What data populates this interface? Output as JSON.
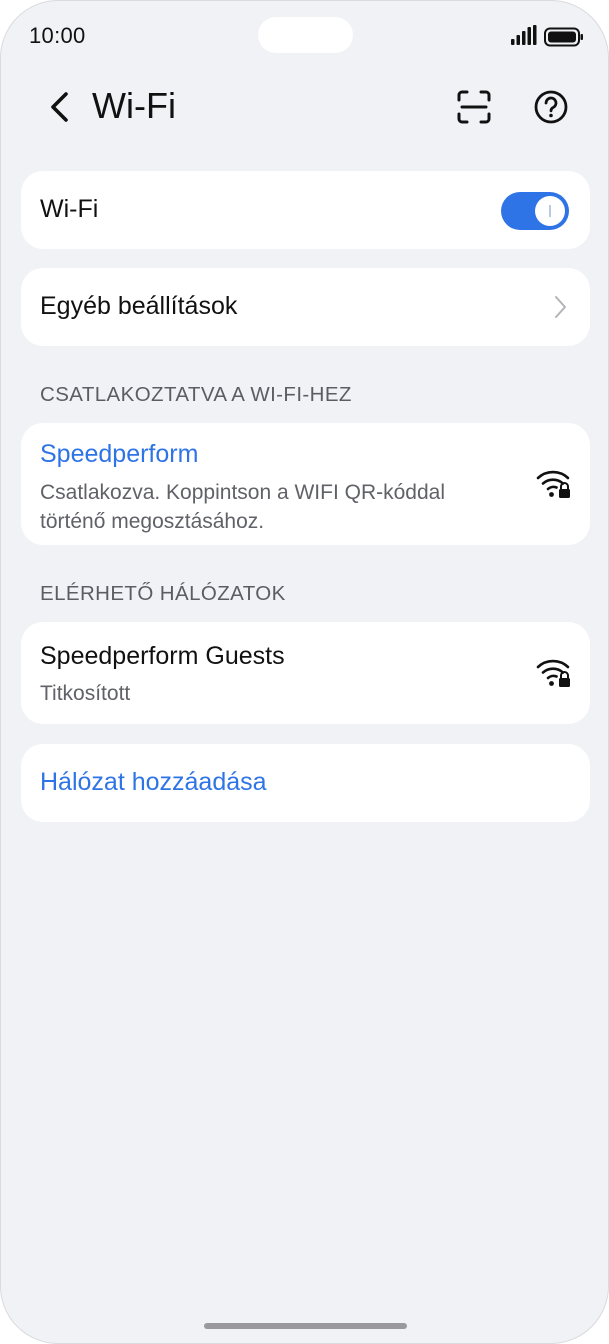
{
  "status_bar": {
    "time": "10:00",
    "icons": [
      "signal-icon",
      "battery-icon"
    ]
  },
  "header": {
    "title": "Wi-Fi",
    "back_icon": "chevron-left-icon",
    "scan_icon": "scan-icon",
    "help_icon": "help-icon"
  },
  "wifi_toggle": {
    "label": "Wi-Fi",
    "enabled": true
  },
  "other_settings": {
    "label": "Egyéb beállítások"
  },
  "connected": {
    "section_title": "CSATLAKOZTATVA A WI-FI-HEZ",
    "name": "Speedperform",
    "status_line1": "Csatlakozva. Koppintson a WIFI QR-kóddal",
    "status_line2": "történő megosztásához."
  },
  "available": {
    "section_title": "ELÉRHETŐ HÁLÓZATOK",
    "networks": [
      {
        "name": "Speedperform Guests",
        "security": "Titkosított"
      }
    ]
  },
  "add_network": {
    "label": "Hálózat hozzáadása"
  },
  "colors": {
    "accent": "#2f74e6",
    "background": "#f1f2f6",
    "card": "#ffffff"
  }
}
